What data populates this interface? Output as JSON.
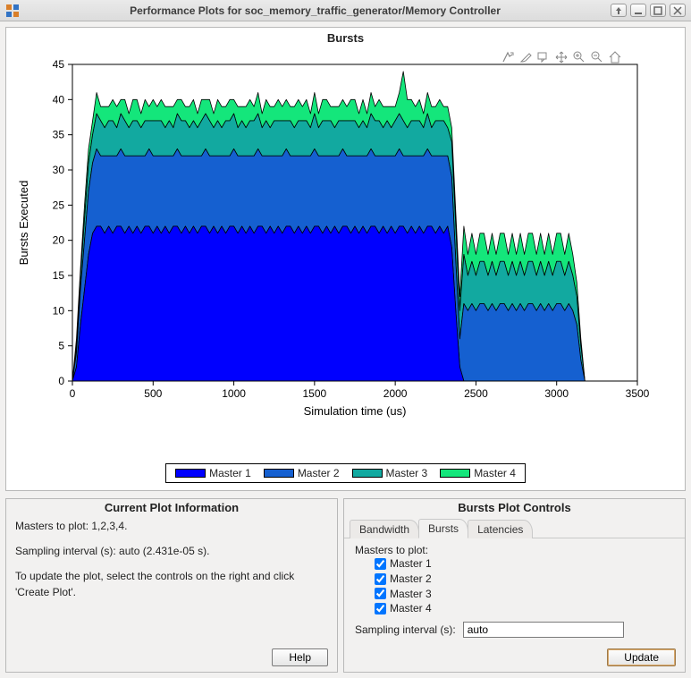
{
  "window": {
    "title": "Performance Plots for soc_memory_traffic_generator/Memory Controller"
  },
  "chart_data": {
    "type": "area",
    "title": "Bursts",
    "xlabel": "Simulation time (us)",
    "ylabel": "Bursts Executed",
    "xlim": [
      0,
      3500
    ],
    "ylim": [
      0,
      45
    ],
    "xticks": [
      0,
      500,
      1000,
      1500,
      2000,
      2500,
      3000,
      3500
    ],
    "yticks": [
      0,
      5,
      10,
      15,
      20,
      25,
      30,
      35,
      40,
      45
    ],
    "x": [
      0,
      25,
      50,
      75,
      100,
      125,
      150,
      175,
      200,
      225,
      250,
      275,
      300,
      325,
      350,
      375,
      400,
      425,
      450,
      475,
      500,
      525,
      550,
      575,
      600,
      625,
      650,
      675,
      700,
      725,
      750,
      775,
      800,
      825,
      850,
      875,
      900,
      925,
      950,
      975,
      1000,
      1025,
      1050,
      1075,
      1100,
      1125,
      1150,
      1175,
      1200,
      1225,
      1250,
      1275,
      1300,
      1325,
      1350,
      1375,
      1400,
      1425,
      1450,
      1475,
      1500,
      1525,
      1550,
      1575,
      1600,
      1625,
      1650,
      1675,
      1700,
      1725,
      1750,
      1775,
      1800,
      1825,
      1850,
      1875,
      1900,
      1925,
      1950,
      1975,
      2000,
      2025,
      2050,
      2075,
      2100,
      2125,
      2150,
      2175,
      2200,
      2225,
      2250,
      2275,
      2300,
      2325,
      2350,
      2375,
      2400,
      2425,
      2450,
      2475,
      2500,
      2525,
      2550,
      2575,
      2600,
      2625,
      2650,
      2675,
      2700,
      2725,
      2750,
      2775,
      2800,
      2825,
      2850,
      2875,
      2900,
      2925,
      2950,
      2975,
      3000,
      3025,
      3050,
      3075,
      3100,
      3125,
      3150,
      3175
    ],
    "series": [
      {
        "name": "Master 1",
        "color": "#0000ff",
        "values": [
          0,
          2,
          8,
          13,
          18,
          21,
          22,
          22,
          21,
          22,
          21,
          22,
          22,
          21,
          22,
          21,
          22,
          21,
          22,
          22,
          21,
          22,
          21,
          22,
          21,
          22,
          22,
          21,
          22,
          21,
          22,
          21,
          22,
          22,
          21,
          22,
          21,
          22,
          21,
          22,
          22,
          21,
          22,
          21,
          22,
          21,
          22,
          22,
          21,
          22,
          21,
          22,
          21,
          22,
          22,
          21,
          22,
          21,
          22,
          21,
          22,
          22,
          21,
          22,
          21,
          22,
          21,
          22,
          22,
          21,
          22,
          21,
          22,
          21,
          22,
          22,
          21,
          22,
          21,
          22,
          21,
          22,
          22,
          21,
          22,
          21,
          22,
          21,
          22,
          22,
          21,
          22,
          21,
          22,
          19,
          10,
          2,
          0,
          0,
          0,
          0,
          0,
          0,
          0,
          0,
          0,
          0,
          0,
          0,
          0,
          0,
          0,
          0,
          0,
          0,
          0,
          0,
          0,
          0,
          0,
          0,
          0,
          0,
          0,
          0,
          0,
          0,
          0
        ]
      },
      {
        "name": "Master 2",
        "color": "#1560d0",
        "values": [
          0,
          2,
          5,
          7,
          9,
          10,
          11,
          10,
          11,
          10,
          11,
          10,
          11,
          11,
          10,
          11,
          10,
          11,
          10,
          11,
          11,
          10,
          11,
          10,
          11,
          10,
          11,
          11,
          10,
          11,
          10,
          11,
          10,
          11,
          11,
          10,
          11,
          10,
          11,
          10,
          11,
          11,
          10,
          11,
          10,
          11,
          11,
          10,
          11,
          10,
          11,
          10,
          11,
          11,
          10,
          11,
          10,
          11,
          10,
          11,
          11,
          10,
          11,
          10,
          11,
          10,
          11,
          11,
          10,
          11,
          10,
          11,
          10,
          11,
          11,
          10,
          11,
          10,
          11,
          10,
          11,
          11,
          10,
          11,
          10,
          11,
          10,
          11,
          11,
          10,
          11,
          10,
          11,
          10,
          10,
          7,
          4,
          11,
          10,
          11,
          10,
          11,
          11,
          10,
          11,
          10,
          11,
          11,
          10,
          11,
          10,
          11,
          10,
          11,
          11,
          10,
          11,
          10,
          11,
          10,
          11,
          11,
          10,
          11,
          10,
          8,
          3,
          0
        ]
      },
      {
        "name": "Master 3",
        "color": "#12a9a0",
        "values": [
          0,
          1,
          2,
          3,
          4,
          4,
          5,
          5,
          4,
          5,
          5,
          4,
          5,
          5,
          4,
          5,
          5,
          4,
          5,
          4,
          5,
          5,
          5,
          4,
          5,
          4,
          5,
          5,
          5,
          4,
          5,
          4,
          5,
          5,
          5,
          4,
          5,
          4,
          5,
          5,
          5,
          4,
          5,
          4,
          5,
          5,
          5,
          4,
          5,
          4,
          5,
          5,
          5,
          4,
          5,
          4,
          5,
          5,
          5,
          4,
          5,
          4,
          5,
          5,
          5,
          4,
          5,
          4,
          5,
          5,
          5,
          4,
          5,
          4,
          5,
          5,
          5,
          4,
          5,
          4,
          5,
          5,
          5,
          4,
          5,
          5,
          5,
          4,
          5,
          4,
          5,
          5,
          5,
          4,
          5,
          5,
          4,
          7,
          5,
          6,
          5,
          6,
          6,
          5,
          6,
          5,
          6,
          6,
          5,
          6,
          5,
          6,
          5,
          6,
          6,
          5,
          6,
          5,
          6,
          5,
          6,
          6,
          5,
          6,
          5,
          4,
          2,
          0
        ]
      },
      {
        "name": "Master 4",
        "color": "#14e67b",
        "values": [
          0,
          1,
          1,
          2,
          2,
          2,
          3,
          2,
          3,
          2,
          3,
          3,
          2,
          3,
          2,
          3,
          3,
          2,
          3,
          2,
          3,
          2,
          3,
          3,
          2,
          3,
          2,
          3,
          2,
          3,
          3,
          2,
          3,
          2,
          3,
          2,
          3,
          3,
          2,
          3,
          2,
          3,
          2,
          3,
          3,
          2,
          3,
          2,
          3,
          3,
          2,
          3,
          2,
          3,
          2,
          3,
          3,
          2,
          3,
          2,
          3,
          2,
          3,
          3,
          2,
          3,
          2,
          3,
          2,
          3,
          3,
          2,
          3,
          2,
          3,
          2,
          3,
          3,
          2,
          3,
          2,
          3,
          7,
          4,
          3,
          2,
          3,
          2,
          3,
          3,
          2,
          3,
          2,
          3,
          2,
          2,
          2,
          4,
          3,
          4,
          3,
          4,
          4,
          3,
          4,
          3,
          4,
          4,
          3,
          4,
          3,
          4,
          3,
          4,
          4,
          3,
          4,
          3,
          4,
          3,
          4,
          4,
          3,
          4,
          3,
          2,
          1,
          0
        ]
      }
    ],
    "legend_position": "bottom"
  },
  "info_panel": {
    "title": "Current Plot Information",
    "line1": "Masters to plot: 1,2,3,4.",
    "line2": "Sampling interval (s): auto (2.431e-05 s).",
    "line3": "To update the plot, select the controls on the right and click 'Create Plot'.",
    "help_label": "Help"
  },
  "controls_panel": {
    "title": "Bursts Plot Controls",
    "tabs": [
      "Bandwidth",
      "Bursts",
      "Latencies"
    ],
    "active_tab": 1,
    "masters_label": "Masters to plot:",
    "masters": [
      {
        "label": "Master 1",
        "checked": true
      },
      {
        "label": "Master 2",
        "checked": true
      },
      {
        "label": "Master 3",
        "checked": true
      },
      {
        "label": "Master 4",
        "checked": true
      }
    ],
    "sampling_label": "Sampling interval (s):",
    "sampling_value": "auto",
    "update_label": "Update"
  }
}
